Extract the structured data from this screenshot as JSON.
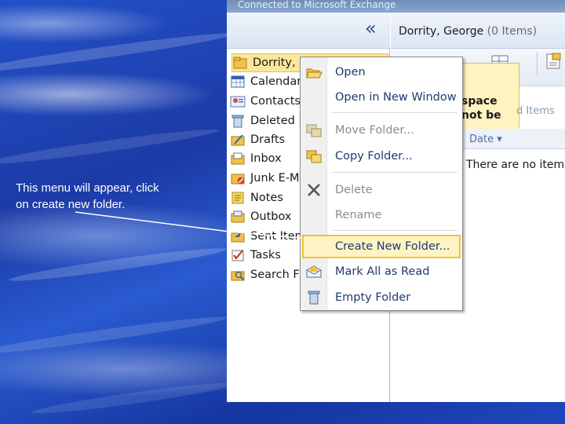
{
  "annotation": {
    "text_line1": "This menu will appear, click",
    "text_line2": "on create new folder."
  },
  "window": {
    "title": "Connected to Microsoft Exchange"
  },
  "folder_pane": {
    "collapse_icon": "«",
    "folders": [
      {
        "label": "Dorrity, George",
        "icon": "mailbox-icon",
        "selected": true
      },
      {
        "label": "Calendar",
        "icon": "calendar-icon"
      },
      {
        "label": "Contacts",
        "icon": "contacts-icon"
      },
      {
        "label": "Deleted Items",
        "icon": "deleted-items-icon"
      },
      {
        "label": "Drafts",
        "icon": "drafts-icon"
      },
      {
        "label": "Inbox",
        "icon": "inbox-icon"
      },
      {
        "label": "Junk E-Mail",
        "icon": "junk-mail-icon"
      },
      {
        "label": "Notes",
        "icon": "notes-icon"
      },
      {
        "label": "Outbox",
        "icon": "outbox-icon"
      },
      {
        "label": "Sent Items",
        "icon": "sent-items-icon"
      },
      {
        "label": "Tasks",
        "icon": "tasks-icon"
      },
      {
        "label": "Search Folders",
        "icon": "search-folder-icon"
      }
    ]
  },
  "content_pane": {
    "title": "Dorrity, George",
    "count": "(0 Items)",
    "tooltip_line1": "space",
    "tooltip_line2": "not be",
    "items_label": "d Items",
    "sort_label": "Date ▾",
    "empty_text": "There are no item"
  },
  "context_menu": {
    "items": [
      {
        "label": "Open",
        "icon": "open-folder-icon",
        "enabled": true
      },
      {
        "label": "Open in New Window",
        "icon": "",
        "enabled": true
      },
      {
        "label": "Move Folder...",
        "icon": "move-folder-icon",
        "enabled": false
      },
      {
        "label": "Copy Folder...",
        "icon": "copy-folder-icon",
        "enabled": true
      },
      {
        "label": "Delete",
        "icon": "delete-x-icon",
        "enabled": false
      },
      {
        "label": "Rename",
        "icon": "",
        "enabled": false
      },
      {
        "label": "Create New Folder...",
        "icon": "",
        "enabled": true,
        "highlighted": true
      },
      {
        "label": "Mark All as Read",
        "icon": "mark-read-icon",
        "enabled": true
      },
      {
        "label": "Empty Folder",
        "icon": "empty-folder-icon",
        "enabled": true
      }
    ]
  },
  "colors": {
    "menu_highlight_border": "#f1c42f",
    "menu_highlight_fill": "#fdf3c3",
    "menu_text": "#1f3a70",
    "menu_disabled_text": "#8d8d8d",
    "background_blue": "#1b3aa6"
  }
}
